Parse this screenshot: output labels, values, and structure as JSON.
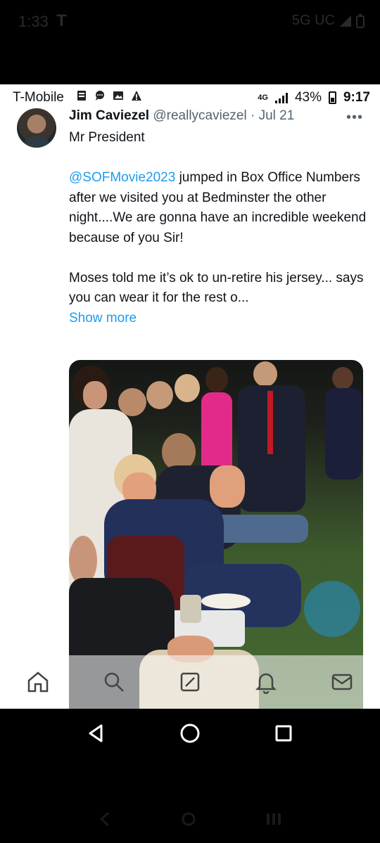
{
  "outer_status": {
    "time": "1:33",
    "carrier_logo": "T",
    "network": "5G UC"
  },
  "inner_status": {
    "carrier": "T-Mobile",
    "notification_icons": [
      "sim-card-icon",
      "chat-bubble-icon",
      "image-icon",
      "warning-icon"
    ],
    "network": "4G",
    "battery": "43%",
    "time": "9:17"
  },
  "tweet": {
    "author_name": "Jim Caviezel",
    "handle": "@reallycaviezel",
    "separator": "·",
    "date": "Jul 21",
    "more_label": "•••",
    "line1": "Mr President",
    "mention": "@SOFMovie2023",
    "paragraph2": " jumped in Box Office Numbers after we visited you at Bedminster the other night....We are gonna have an incredible weekend because of you Sir!",
    "paragraph3": "Moses told me it’s ok to un-retire his jersey... says you can wear it for the rest o...",
    "show_more": "Show more"
  },
  "bottom_nav": {
    "items": [
      "home-icon",
      "search-icon",
      "communities-icon",
      "notifications-icon",
      "messages-icon"
    ]
  },
  "android_nav": {
    "items": [
      "back-icon",
      "home-circle-icon",
      "recents-icon"
    ]
  },
  "colors": {
    "link": "#1d9bf0",
    "text": "#0f1419",
    "secondary": "#536471"
  }
}
